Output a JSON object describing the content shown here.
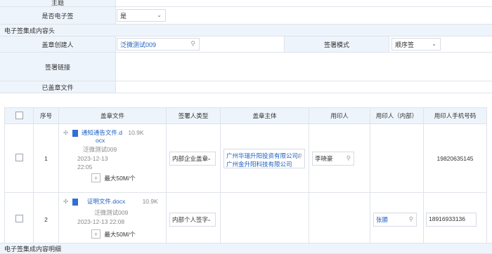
{
  "form": {
    "topic_label": "主题",
    "esign_label": "是否电子签",
    "esign_value": "是",
    "section_header": "电子签集成内容头",
    "creator_label": "盖章创建人",
    "creator_value": "泛微测试009",
    "mode_label": "签署模式",
    "mode_value": "顺序签",
    "link_label": "签署链接",
    "signed_label": "已盖章文件",
    "bottom_section": "电子签集成内容明细"
  },
  "table": {
    "headers": [
      "序号",
      "盖章文件",
      "签署人类型",
      "盖章主体",
      "用印人",
      "用印人（内部）",
      "用印人手机号码"
    ],
    "rows": [
      {
        "index": "1",
        "file_name_1": "通知通告文件.d",
        "file_name_2": "ocx",
        "file_size": "10.9K",
        "uploader": "泛微测试009",
        "date": "2023-12-13",
        "time": "22:05",
        "max_label": "最大50M/个",
        "signer_type": "内部企业盖章",
        "entity_line1": "广州华瑞升阳投资有限公司/",
        "entity_line2": "广州金升阳科技有限公司",
        "user": "李晓豪",
        "internal_user": "",
        "phone": "19820635145"
      },
      {
        "index": "2",
        "file_name_1": "证明文件.docx",
        "file_name_2": "",
        "file_size": "10.9K",
        "uploader": "泛微测试009",
        "date": "2023-12-13 22:08",
        "time": "",
        "max_label": "最大50M/个",
        "signer_type": "内部个人签字",
        "entity_line1": "",
        "entity_line2": "",
        "user": "",
        "internal_user": "张勝",
        "phone": "18916933136"
      }
    ]
  },
  "colors": {
    "label_bg": "#eef4fb",
    "border": "#dfe3ea",
    "link": "#1f5fbf"
  }
}
